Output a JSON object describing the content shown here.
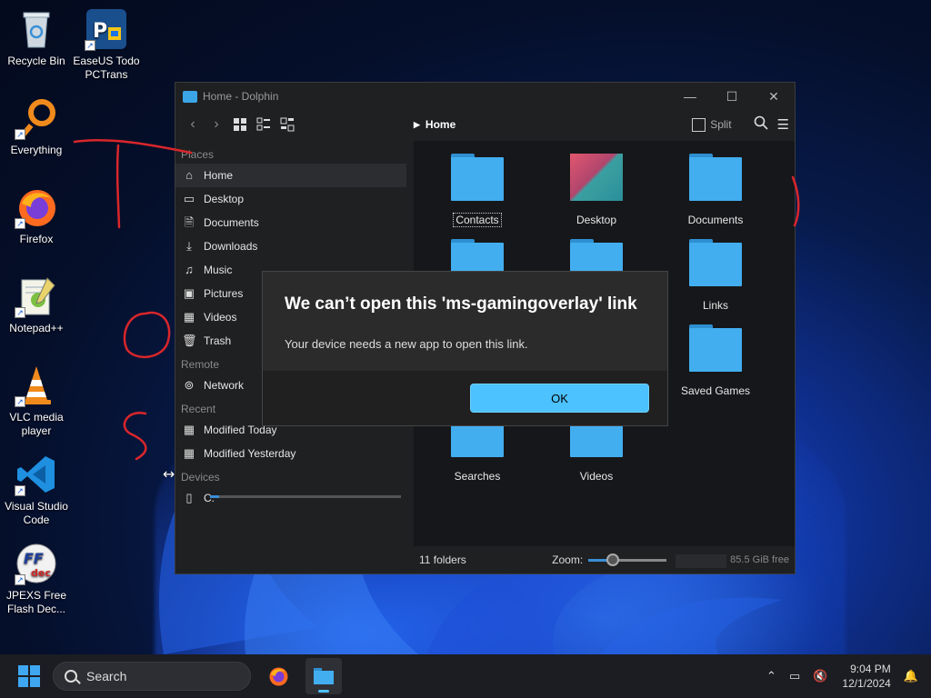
{
  "desktop": {
    "icons": [
      {
        "label": "Recycle Bin"
      },
      {
        "label": "EaseUS Todo PCTrans"
      },
      {
        "label": "Everything"
      },
      {
        "label": "Firefox"
      },
      {
        "label": "Notepad++"
      },
      {
        "label": "VLC media player"
      },
      {
        "label": "Visual Studio Code"
      },
      {
        "label": "JPEXS Free Flash Dec..."
      }
    ]
  },
  "window": {
    "title": "Home - Dolphin",
    "breadcrumb": "Home",
    "split_label": "Split",
    "sidebar": {
      "places_header": "Places",
      "places": [
        {
          "label": "Home",
          "icon": "home-icon"
        },
        {
          "label": "Desktop",
          "icon": "desktop-icon"
        },
        {
          "label": "Documents",
          "icon": "documents-icon"
        },
        {
          "label": "Downloads",
          "icon": "download-icon"
        },
        {
          "label": "Music",
          "icon": "music-icon"
        },
        {
          "label": "Pictures",
          "icon": "pictures-icon"
        },
        {
          "label": "Videos",
          "icon": "videos-icon"
        },
        {
          "label": "Trash",
          "icon": "trash-icon"
        }
      ],
      "remote_header": "Remote",
      "remote": [
        {
          "label": "Network",
          "icon": "network-icon"
        }
      ],
      "recent_header": "Recent",
      "recent": [
        {
          "label": "Modified Today",
          "icon": "calendar-icon"
        },
        {
          "label": "Modified Yesterday",
          "icon": "calendar-icon"
        }
      ],
      "devices_header": "Devices",
      "devices": [
        {
          "label": "C:",
          "icon": "drive-icon"
        }
      ]
    },
    "folders": [
      {
        "label": "Contacts"
      },
      {
        "label": "Desktop"
      },
      {
        "label": "Documents"
      },
      {
        "label": "Links"
      },
      {
        "label": "Saved Games"
      },
      {
        "label": "Searches"
      },
      {
        "label": "Videos"
      }
    ],
    "status": {
      "folder_count": "11 folders",
      "zoom_label": "Zoom:",
      "free_space": "85.5 GiB free"
    }
  },
  "dialog": {
    "title": "We can’t open this 'ms-gamingoverlay' link",
    "message": "Your device needs a new app to open this link.",
    "ok_label": "OK"
  },
  "taskbar": {
    "search_label": "Search",
    "time": "9:04 PM",
    "date": "12/1/2024"
  },
  "colors": {
    "accent": "#4cc2ff",
    "folder": "#42aef0",
    "annotation": "#d9262b"
  }
}
